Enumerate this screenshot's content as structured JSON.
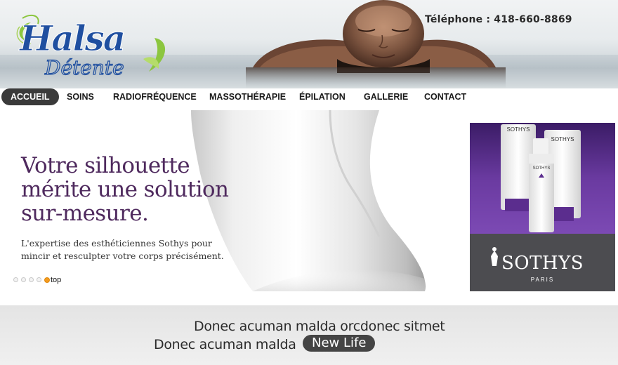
{
  "header": {
    "logo_text_main": "Halsa",
    "logo_text_sub": "Détente",
    "phone": "Téléphone : 418-660-8869"
  },
  "nav": {
    "items": [
      {
        "label": "ACCUEIL",
        "active": true
      },
      {
        "label": "SOINS",
        "active": false
      },
      {
        "label": "RADIOFRÉQUENCE",
        "active": false
      },
      {
        "label": "MASSOTHÉRAPIE",
        "active": false
      },
      {
        "label": "ÉPILATION",
        "active": false
      },
      {
        "label": "GALLERIE",
        "active": false
      },
      {
        "label": "CONTACT",
        "active": false
      }
    ]
  },
  "slider": {
    "headline": "Votre silhouette mérite une solution sur-mesure.",
    "subtext": "L'expertise des esthéticiennes Sothys pour mincir et resculpter votre corps précisément.",
    "slide_count": 5,
    "active_slide": 5,
    "top_label": "top"
  },
  "ad": {
    "brand": "SOTHYS",
    "brand_sub": "PARIS",
    "product_label": "SOTHYS"
  },
  "band": {
    "line1": "Donec acuman malda orcdonec sitmet",
    "line2": "Donec acuman malda",
    "button": "New Life"
  },
  "colors": {
    "headline": "#4f2a5e",
    "nav_active_bg": "#3a3a3a",
    "logo_blue": "#1f4fa0",
    "logo_green": "#8cc63f",
    "ad_purple": "#5b2d8e",
    "slider_dot_active": "#f39b1f"
  }
}
